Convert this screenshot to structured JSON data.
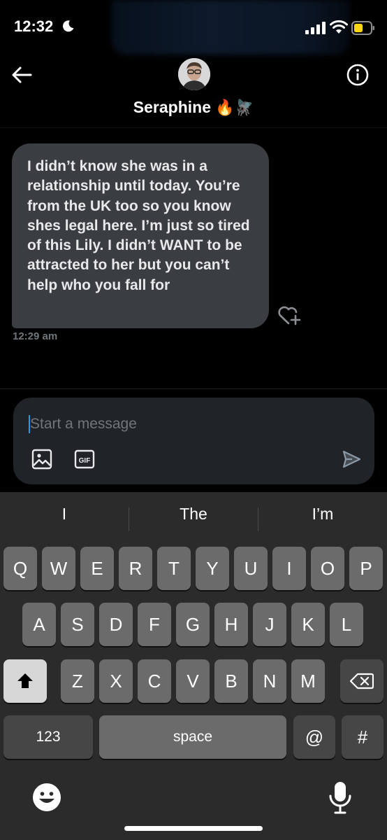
{
  "status_bar": {
    "time": "12:32"
  },
  "header": {
    "contact_name": "Seraphine",
    "name_emojis": "🔥🪰"
  },
  "messages": [
    {
      "text": "I didn’t know she was in a relationship until today. You’re from the UK too so you know shes legal here. I’m just so tired of this Lily. I didn’t WANT to be attracted to her but you can’t help who you fall for",
      "time": "12:29 am"
    }
  ],
  "composer": {
    "placeholder": "Start a message",
    "gif_label": "GIF"
  },
  "keyboard": {
    "suggestions": [
      "I",
      "The",
      "I’m"
    ],
    "row1": [
      "Q",
      "W",
      "E",
      "R",
      "T",
      "Y",
      "U",
      "I",
      "O",
      "P"
    ],
    "row2": [
      "A",
      "S",
      "D",
      "F",
      "G",
      "H",
      "J",
      "K",
      "L"
    ],
    "row3": [
      "Z",
      "X",
      "C",
      "V",
      "B",
      "N",
      "M"
    ],
    "numbers_label": "123",
    "space_label": "space",
    "at_label": "@",
    "hash_label": "#"
  },
  "colors": {
    "accent": "#1d9bf0",
    "bubble": "#3a3d41",
    "composer": "#202327",
    "keyboard_bg": "#2b2b2b",
    "key": "#6b6b6b"
  }
}
